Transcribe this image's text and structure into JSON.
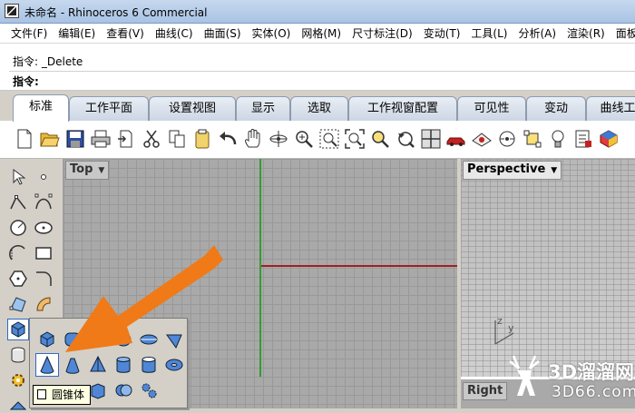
{
  "window": {
    "title": "未命名 - Rhinoceros 6 Commercial"
  },
  "menu": [
    "文件(F)",
    "编辑(E)",
    "查看(V)",
    "曲线(C)",
    "曲面(S)",
    "实体(O)",
    "网格(M)",
    "尺寸标注(D)",
    "变动(T)",
    "工具(L)",
    "分析(A)",
    "渲染(R)",
    "面板"
  ],
  "command": {
    "history": "指令: _Delete",
    "prompt_label": "指令:",
    "input_value": ""
  },
  "tabs": [
    "标准",
    "工作平面",
    "设置视图",
    "显示",
    "选取",
    "工作视窗配置",
    "可见性",
    "变动",
    "曲线工"
  ],
  "toolbar_icons": [
    "new-file-icon",
    "open-folder-icon",
    "save-icon",
    "print-icon",
    "import-icon",
    "cut-icon",
    "copy-icon",
    "paste-icon",
    "undo-icon",
    "pan-hand-icon",
    "rotate-view-icon",
    "zoom-icon",
    "zoom-window-icon",
    "zoom-extents-icon",
    "zoom-selected-icon",
    "undo-view-icon",
    "four-viewports-icon",
    "car-icon",
    "render-preview-icon",
    "snap-icon",
    "lightbulb-icon",
    "layer-icon",
    "display-mode-icon"
  ],
  "viewports": {
    "top": "Top",
    "perspective": "Perspective",
    "right": "Right",
    "axis_y": "y",
    "axis_z": "z"
  },
  "tooltip": "圆锥体",
  "watermark": {
    "brand": "3D溜溜网",
    "site": "3D66.com"
  },
  "colors": {
    "axis_x": "#a02020",
    "axis_y": "#2f9e2f",
    "arrow": "#f07a18",
    "highlight": "#316ac5"
  }
}
